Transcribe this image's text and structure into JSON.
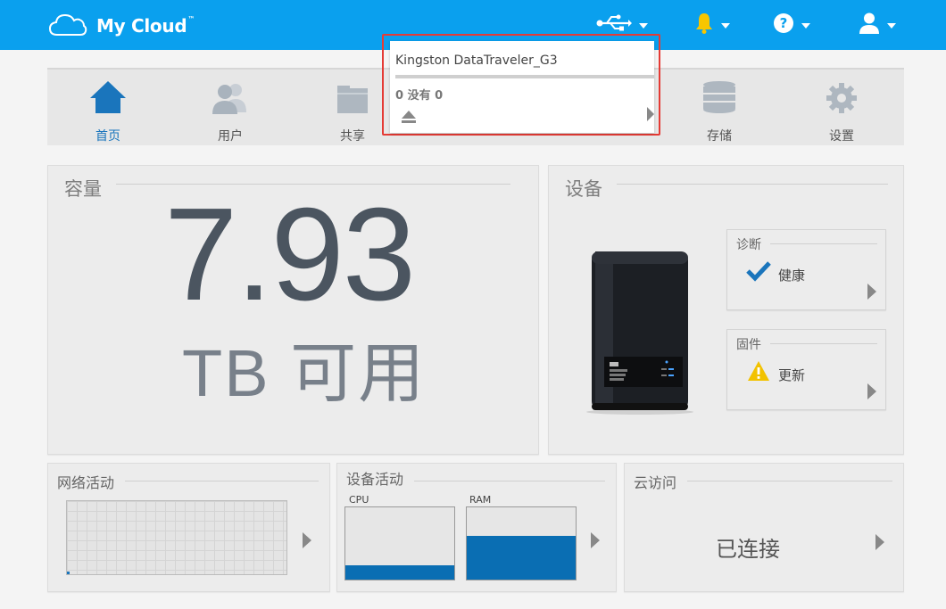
{
  "header": {
    "app_title": "My Cloud",
    "trademark": "™",
    "icons": [
      "usb-icon",
      "bell-icon",
      "help-icon",
      "user-icon"
    ],
    "accent_color": "#0aa0ee"
  },
  "nav": {
    "items": [
      {
        "label": "首页",
        "icon": "home-icon",
        "active": true
      },
      {
        "label": "用户",
        "icon": "users-icon"
      },
      {
        "label": "共享",
        "icon": "folder-icon"
      },
      {
        "label": "存储",
        "icon": "storage-icon"
      },
      {
        "label": "设置",
        "icon": "gear-icon"
      }
    ]
  },
  "usb_popup": {
    "device_name": "Kingston DataTraveler_G3",
    "usage": "0 没有 0",
    "eject_icon": "eject-icon"
  },
  "capacity": {
    "title": "容量",
    "value": "7.93",
    "unit": "TB 可用"
  },
  "device": {
    "title": "设备",
    "diagnostics": {
      "title": "诊断",
      "status": "健康",
      "icon": "check-icon"
    },
    "firmware": {
      "title": "固件",
      "status": "更新",
      "icon": "warning-icon"
    }
  },
  "network": {
    "title": "网络活动"
  },
  "device_activity": {
    "title": "设备活动",
    "cpu_label": "CPU",
    "ram_label": "RAM",
    "cpu_level": 0.2,
    "ram_level": 0.6
  },
  "cloud_access": {
    "title": "云访问",
    "status": "已连接"
  }
}
